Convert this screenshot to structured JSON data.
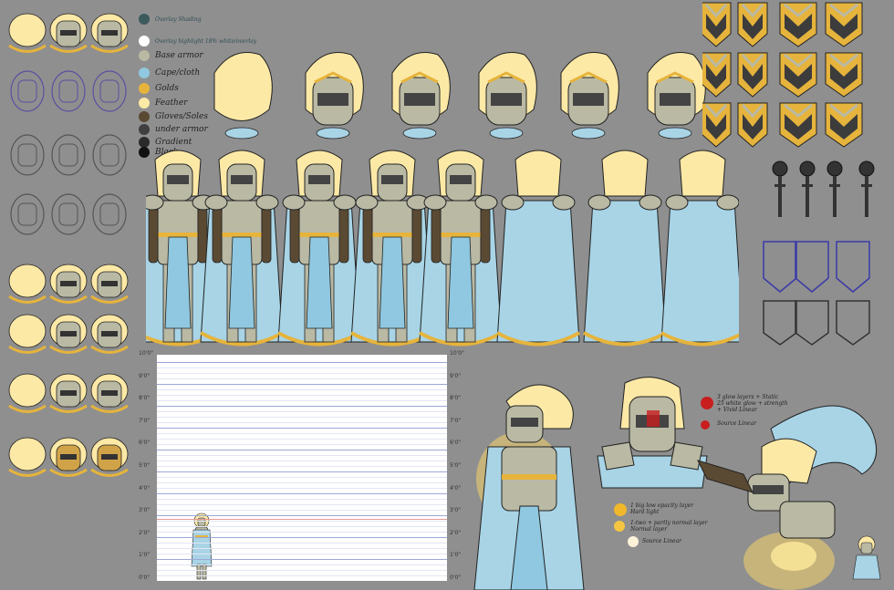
{
  "colors": {
    "background": "#8f8f8f",
    "cape": "#a8d4e6",
    "gold": "#e6b43c",
    "feather": "#fde9a6",
    "armor": "#b9b9a4",
    "under": "#3f3528",
    "outline": "#222222"
  },
  "legend": {
    "items": [
      {
        "label": "Overlay Shading",
        "color": "#3c5a5c"
      },
      {
        "label": "Overlay highlight 18% white/overlay",
        "color": "#ffffff"
      },
      {
        "label": "Base armor",
        "color": "#b9b9a4"
      },
      {
        "label": "Cape/cloth",
        "color": "#8fc8e0"
      },
      {
        "label": "Golds",
        "color": "#e6b43c"
      },
      {
        "label": "Feather",
        "color": "#fde9a6"
      },
      {
        "label": "Gloves/Soles",
        "color": "#5b4a33"
      },
      {
        "label": "under armor",
        "color": "#3f3f3f"
      },
      {
        "label": "Gradient",
        "color": "#2a2a2a"
      },
      {
        "label": "Black",
        "color": "#111111"
      }
    ]
  },
  "height_chart": {
    "ticks": [
      "0'0\"",
      "1'0\"",
      "2'0\"",
      "3'0\"",
      "4'0\"",
      "5'0\"",
      "6'0\"",
      "7'0\"",
      "8'0\"",
      "9'0\"",
      "10'0\""
    ]
  },
  "notes": {
    "left": [
      {
        "text": "3 glow layers + Static\n25 white glow + strength\n+ Vivid Linear",
        "color": "#c81e1e"
      },
      {
        "text": "Source Linear",
        "color": "#c81e1e"
      }
    ],
    "bottom": [
      {
        "text": "1 big low opacity layer\nHard light",
        "color": "#f0b82a"
      },
      {
        "text": "1-two + partly normal layer\nNormal layer",
        "color": "#f5c542"
      },
      {
        "text": "Source Linear",
        "color": "#fbf2d8"
      }
    ]
  }
}
